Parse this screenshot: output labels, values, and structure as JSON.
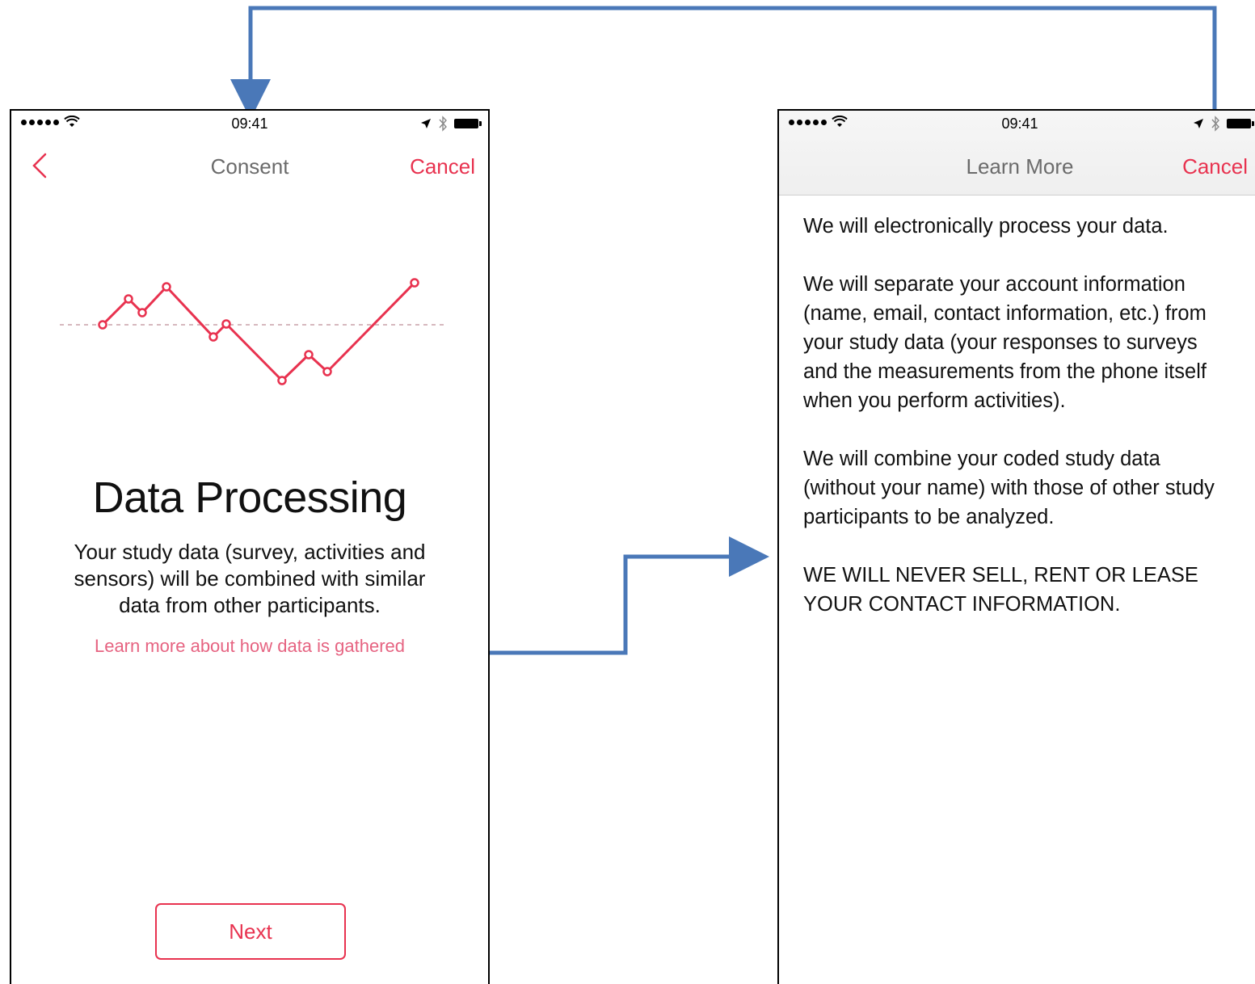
{
  "left_screen": {
    "status": {
      "time": "09:41"
    },
    "nav": {
      "back_icon": "chevron-left-icon",
      "title": "Consent",
      "cancel": "Cancel"
    },
    "title": "Data Processing",
    "body": "Your study data (survey, activities and sensors) will be combined with similar data from other participants.",
    "link": "Learn more about how data is gathered",
    "next": "Next"
  },
  "right_screen": {
    "status": {
      "time": "09:41"
    },
    "nav": {
      "title": "Learn More",
      "cancel": "Cancel"
    },
    "paragraphs": [
      "We will electronically process your data.",
      "We will separate your account information (name, email, contact information, etc.) from your study data (your responses to surveys and the measurements from the phone itself when you perform activities).",
      "We will combine your coded study data (without your name) with those of other study participants to be analyzed.",
      "WE WILL NEVER SELL, RENT OR LEASE YOUR CONTACT INFORMATION."
    ]
  },
  "colors": {
    "accent": "#e8324f",
    "link": "#e66381",
    "connector": "#4a78b8"
  }
}
